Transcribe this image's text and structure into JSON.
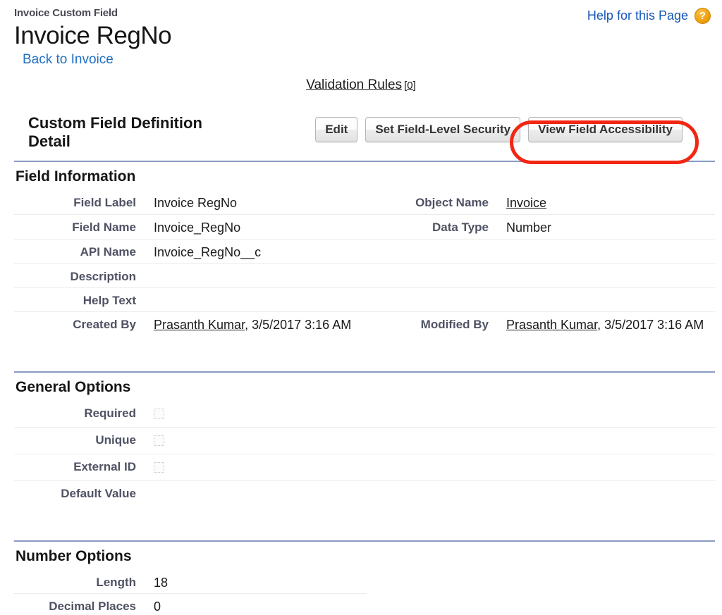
{
  "header": {
    "eyebrow": "Invoice Custom Field",
    "title": "Invoice RegNo",
    "back_link": "Back to Invoice",
    "help_link": "Help for this Page",
    "help_icon": "question-mark-icon",
    "help_icon_glyph": "?",
    "help_icon_color": "#f0a30f"
  },
  "related": {
    "validation_rules_label": "Validation Rules",
    "validation_rules_count": "[0]"
  },
  "detail": {
    "title": "Custom Field Definition Detail",
    "buttons": [
      {
        "label": "Edit",
        "name": "edit-button",
        "highlighted": false
      },
      {
        "label": "Set Field-Level Security",
        "name": "set-field-level-security-button",
        "highlighted": false
      },
      {
        "label": "View Field Accessibility",
        "name": "view-field-accessibility-button",
        "highlighted": true
      }
    ],
    "highlight_color": "#f22613"
  },
  "sections": {
    "field_information": {
      "title": "Field Information",
      "rows": [
        {
          "left_label": "Field Label",
          "left_value": "Invoice RegNo",
          "right_label": "Object Name",
          "right_value": "Invoice",
          "right_is_link": true
        },
        {
          "left_label": "Field Name",
          "left_value": "Invoice_RegNo",
          "right_label": "Data Type",
          "right_value": "Number"
        },
        {
          "left_label": "API Name",
          "left_value": "Invoice_RegNo__c",
          "right_label": "",
          "right_value": ""
        },
        {
          "left_label": "Description",
          "left_value": "",
          "right_label": "",
          "right_value": ""
        },
        {
          "left_label": "Help Text",
          "left_value": "",
          "right_label": "",
          "right_value": ""
        },
        {
          "left_label": "Created By",
          "left_link": "Prasanth Kumar",
          "left_value": ", 3/5/2017 3:16 AM",
          "right_label": "Modified By",
          "right_link": "Prasanth Kumar",
          "right_value": ", 3/5/2017 3:16 AM"
        }
      ]
    },
    "general_options": {
      "title": "General Options",
      "rows": [
        {
          "label": "Required",
          "checkbox": true,
          "checked": false,
          "value": ""
        },
        {
          "label": "Unique",
          "checkbox": true,
          "checked": false,
          "value": ""
        },
        {
          "label": "External ID",
          "checkbox": true,
          "checked": false,
          "value": ""
        },
        {
          "label": "Default Value",
          "checkbox": false,
          "checked": false,
          "value": ""
        }
      ]
    },
    "number_options": {
      "title": "Number Options",
      "rows": [
        {
          "label": "Length",
          "value": "18"
        },
        {
          "label": "Decimal Places",
          "value": "0"
        }
      ]
    }
  }
}
